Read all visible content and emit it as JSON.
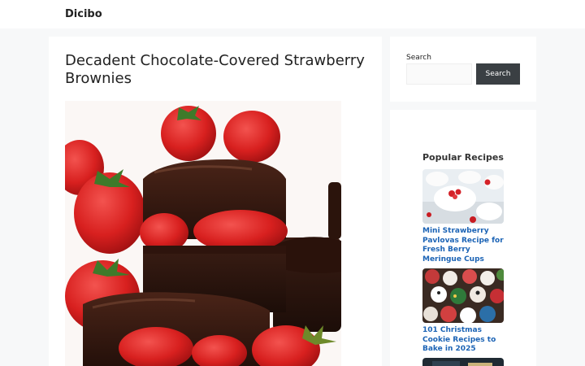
{
  "header": {
    "site_title": "Dicibo"
  },
  "post": {
    "title": "Decadent Chocolate-Covered Strawberry Brownies",
    "image_icon": "chocolate-strawberry-brownies-photo"
  },
  "sidebar": {
    "search": {
      "label": "Search",
      "input_value": "",
      "button_label": "Search"
    },
    "popular": {
      "title": "Popular Recipes",
      "items": [
        {
          "title": "Mini Strawberry Pavlovas Recipe for Fresh Berry Meringue Cups",
          "icon": "pavlova-photo"
        },
        {
          "title": "101 Christmas Cookie Recipes to Bake in 2025",
          "icon": "christmas-cookies-photo"
        },
        {
          "title": "",
          "icon": "recipe-photo"
        }
      ]
    }
  },
  "colors": {
    "link": "#1b63b5",
    "button": "#3a3f43",
    "background": "#f7f8f9"
  }
}
